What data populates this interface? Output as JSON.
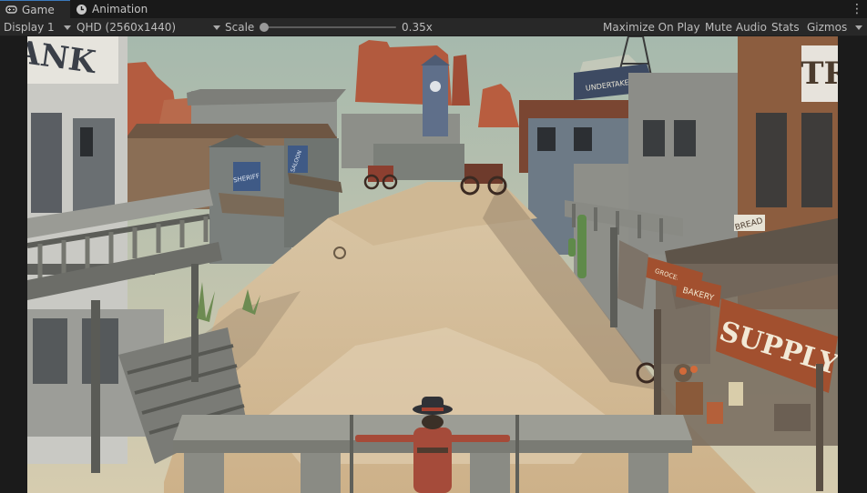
{
  "tabs": [
    {
      "label": "Game",
      "icon": "gamepad-icon",
      "active": true
    },
    {
      "label": "Animation",
      "icon": "animation-icon",
      "active": false
    }
  ],
  "toolbar": {
    "display": "Display 1",
    "resolution": "QHD (2560x1440)",
    "scale_label": "Scale",
    "scale_value": "0.35x",
    "maximize": "Maximize On Play",
    "mute": "Mute Audio",
    "stats": "Stats",
    "gizmos": "Gizmos"
  },
  "scene": {
    "signs": {
      "bank": "ANK",
      "sheriff": "SHERIFF",
      "saloon": "SALOON",
      "undertaker": "UNDERTAKER",
      "trade": "TR",
      "bread": "BREAD",
      "supply": "SUPPLY",
      "bakery": "BAKERY",
      "groceries": "GROCERIES"
    },
    "colors": {
      "sky": "#9fb3a6",
      "sand": "#d8bf99",
      "rock": "#b4583c",
      "wood_gray": "#8c8f8c",
      "wood_brown": "#8a5a3a",
      "sign_blue": "#3f5a86"
    }
  }
}
